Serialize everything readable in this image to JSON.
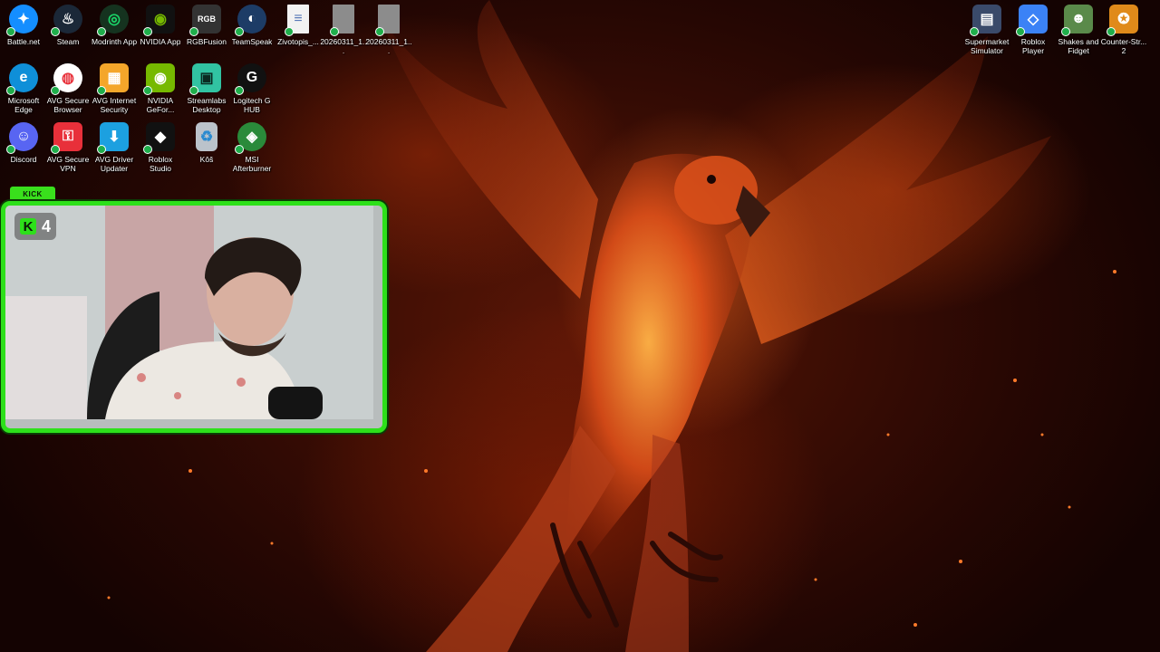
{
  "desktop": {
    "icons": [
      {
        "label": "Battle.net",
        "icon": "battlenet-icon",
        "color": "#148eff",
        "glyph": "✦"
      },
      {
        "label": "Steam",
        "icon": "steam-icon",
        "color": "#1b2838",
        "glyph": "♨"
      },
      {
        "label": "Modrinth App",
        "icon": "modrinth-icon",
        "color": "#1bd96a",
        "glyph": "◎"
      },
      {
        "label": "NVIDIA App",
        "icon": "nvidia-icon",
        "color": "#76b900",
        "glyph": "◉"
      },
      {
        "label": "RGBFusion",
        "icon": "rgbfusion-icon",
        "color": "#444444",
        "glyph": "RGB"
      },
      {
        "label": "TeamSpeak",
        "icon": "teamspeak-icon",
        "color": "#2580c3",
        "glyph": "◐"
      },
      {
        "label": "Zivotopis_...",
        "icon": "document-icon",
        "color": "#f2f2f2",
        "glyph": "≡"
      },
      {
        "label": "20260311_1...",
        "icon": "image-file-icon",
        "color": "#9a9a9a",
        "glyph": ""
      },
      {
        "label": "20260311_1...",
        "icon": "image-file-icon",
        "color": "#9a9a9a",
        "glyph": ""
      },
      {
        "label": "Microsoft Edge",
        "icon": "edge-icon",
        "color": "#0f8fd8",
        "glyph": "e"
      },
      {
        "label": "AVG Secure Browser",
        "icon": "avg-browser-icon",
        "color": "#ffffff",
        "glyph": "◍"
      },
      {
        "label": "AVG Internet Security",
        "icon": "avg-security-icon",
        "color": "#f4a62a",
        "glyph": "▦"
      },
      {
        "label": "NVIDIA GeFor...",
        "icon": "geforce-icon",
        "color": "#76b900",
        "glyph": "◉"
      },
      {
        "label": "Streamlabs Desktop",
        "icon": "streamlabs-icon",
        "color": "#31c3a2",
        "glyph": "▣"
      },
      {
        "label": "Logitech G HUB",
        "icon": "logitech-icon",
        "color": "#111111",
        "glyph": "G"
      },
      {
        "label": "Discord",
        "icon": "discord-icon",
        "color": "#5865f2",
        "glyph": "☺"
      },
      {
        "label": "AVG Secure VPN",
        "icon": "avg-vpn-icon",
        "color": "#e8303a",
        "glyph": "🔒"
      },
      {
        "label": "AVG Driver Updater",
        "icon": "avg-driver-icon",
        "color": "#1ca0e0",
        "glyph": "⬇"
      },
      {
        "label": "Roblox Studio",
        "icon": "roblox-studio-icon",
        "color": "#111111",
        "glyph": "◆"
      },
      {
        "label": "Kôš",
        "icon": "recycle-bin-icon",
        "color": "#d6e4ee",
        "glyph": "♻"
      },
      {
        "label": "MSI Afterburner",
        "icon": "msi-afterburner-icon",
        "color": "#2a8a3a",
        "glyph": "◈"
      },
      {
        "label": "Supermarket Simulator",
        "icon": "supermarket-simulator-icon",
        "color": "#3a4a6a",
        "glyph": "▤"
      },
      {
        "label": "Roblox Player",
        "icon": "roblox-player-icon",
        "color": "#3b82f6",
        "glyph": "◇"
      },
      {
        "label": "Shakes and Fidget",
        "icon": "shakes-fidget-icon",
        "color": "#5a8a4a",
        "glyph": "☻"
      },
      {
        "label": "Counter-Str... 2",
        "icon": "counter-strike-icon",
        "color": "#e08a1a",
        "glyph": "✪"
      }
    ]
  },
  "overlay": {
    "tab_label": "KICK",
    "logo_letter": "K",
    "viewer_count": "4",
    "accent_color": "#2de01a"
  },
  "wallpaper": {
    "subject": "phoenix",
    "colors": [
      "#140302",
      "#5a1606",
      "#ff6a1e"
    ]
  }
}
